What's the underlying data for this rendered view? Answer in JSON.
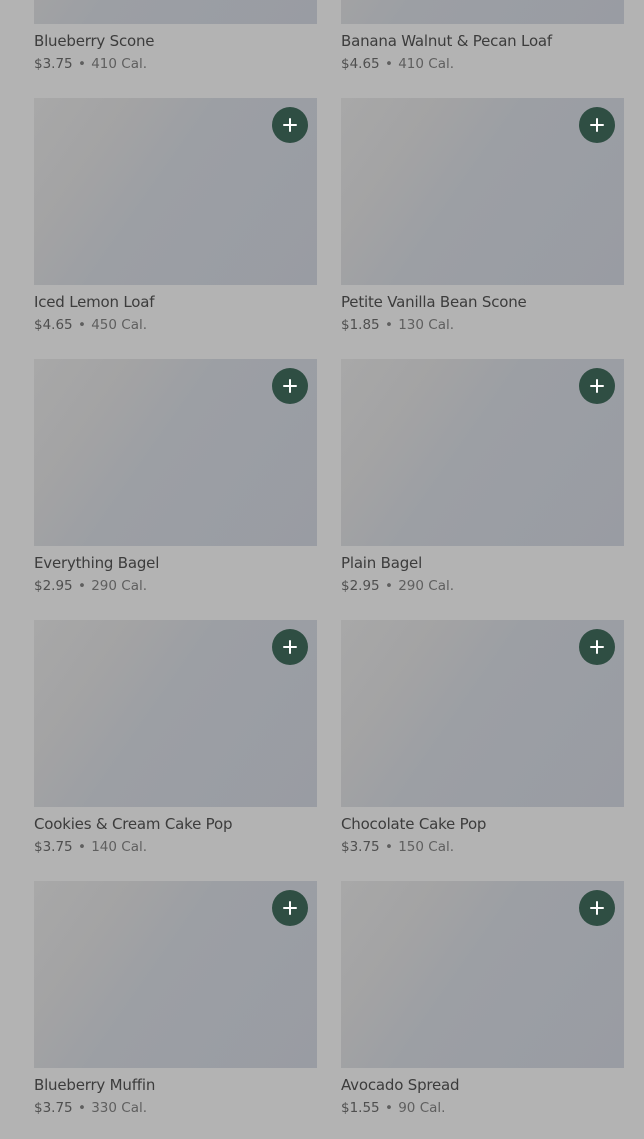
{
  "colors": {
    "page_background": "#b3b3b3",
    "add_button": "#2f4e43",
    "add_icon": "#ffffff",
    "text_primary": "#3c3c3c",
    "text_secondary": "#5f5f5f"
  },
  "icons": {
    "add": "plus-icon"
  },
  "menu": {
    "separator": "•",
    "items": [
      {
        "name": "Blueberry Scone",
        "price": "$3.75",
        "calories": "410 Cal."
      },
      {
        "name": "Banana Walnut & Pecan Loaf",
        "price": "$4.65",
        "calories": "410 Cal."
      },
      {
        "name": "Iced Lemon Loaf",
        "price": "$4.65",
        "calories": "450 Cal."
      },
      {
        "name": "Petite Vanilla Bean Scone",
        "price": "$1.85",
        "calories": "130 Cal."
      },
      {
        "name": "Everything Bagel",
        "price": "$2.95",
        "calories": "290 Cal."
      },
      {
        "name": "Plain Bagel",
        "price": "$2.95",
        "calories": "290 Cal."
      },
      {
        "name": "Cookies & Cream Cake Pop",
        "price": "$3.75",
        "calories": "140 Cal."
      },
      {
        "name": "Chocolate Cake Pop",
        "price": "$3.75",
        "calories": "150 Cal."
      },
      {
        "name": "Blueberry Muffin",
        "price": "$3.75",
        "calories": "330 Cal."
      },
      {
        "name": "Avocado Spread",
        "price": "$1.55",
        "calories": "90 Cal."
      }
    ]
  }
}
